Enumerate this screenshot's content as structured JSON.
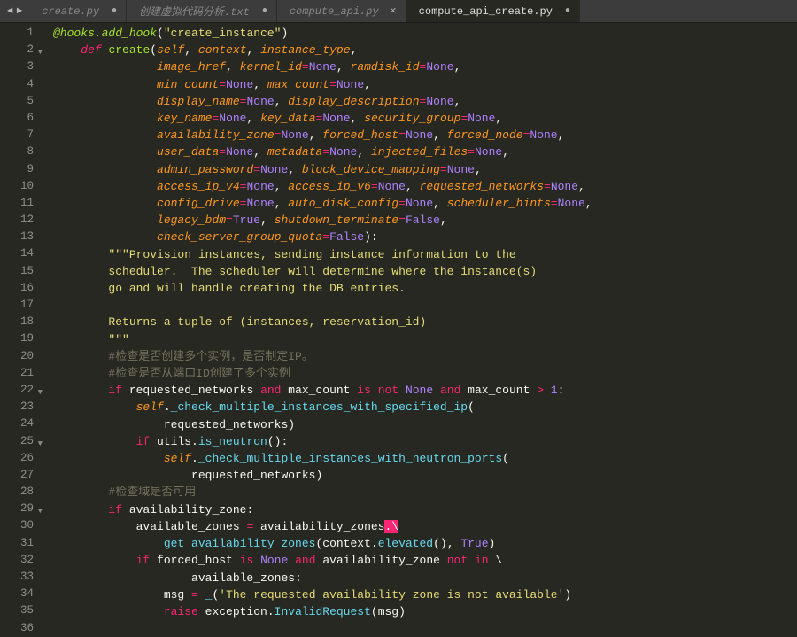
{
  "nav": {
    "back": "◄",
    "forward": "►"
  },
  "tabs": [
    {
      "label": "create.py",
      "modified": true,
      "active": false
    },
    {
      "label": "创建虚拟代码分析.txt",
      "modified": true,
      "active": false
    },
    {
      "label": "compute_api.py",
      "modified": false,
      "active": false
    },
    {
      "label": "compute_api_create.py",
      "modified": true,
      "active": true
    }
  ],
  "lines": [
    {
      "n": 1,
      "fold": "",
      "tokens": [
        [
          "dec",
          "@hooks.add_hook"
        ],
        [
          "var",
          "("
        ],
        [
          "str",
          "\"create_instance\""
        ],
        [
          "var",
          ")"
        ]
      ]
    },
    {
      "n": 2,
      "fold": "▼",
      "tokens": [
        [
          "var",
          "    "
        ],
        [
          "kwit",
          "def"
        ],
        [
          "var",
          " "
        ],
        [
          "fn",
          "create"
        ],
        [
          "var",
          "("
        ],
        [
          "param",
          "self"
        ],
        [
          "var",
          ", "
        ],
        [
          "param",
          "context"
        ],
        [
          "var",
          ", "
        ],
        [
          "param",
          "instance_type"
        ],
        [
          "var",
          ","
        ]
      ]
    },
    {
      "n": 3,
      "fold": "",
      "tokens": [
        [
          "var",
          "               "
        ],
        [
          "param",
          "image_href"
        ],
        [
          "var",
          ", "
        ],
        [
          "param",
          "kernel_id"
        ],
        [
          "op",
          "="
        ],
        [
          "const",
          "None"
        ],
        [
          "var",
          ", "
        ],
        [
          "param",
          "ramdisk_id"
        ],
        [
          "op",
          "="
        ],
        [
          "const",
          "None"
        ],
        [
          "var",
          ","
        ]
      ]
    },
    {
      "n": 4,
      "fold": "",
      "tokens": [
        [
          "var",
          "               "
        ],
        [
          "param",
          "min_count"
        ],
        [
          "op",
          "="
        ],
        [
          "const",
          "None"
        ],
        [
          "var",
          ", "
        ],
        [
          "param",
          "max_count"
        ],
        [
          "op",
          "="
        ],
        [
          "const",
          "None"
        ],
        [
          "var",
          ","
        ]
      ]
    },
    {
      "n": 5,
      "fold": "",
      "tokens": [
        [
          "var",
          "               "
        ],
        [
          "param",
          "display_name"
        ],
        [
          "op",
          "="
        ],
        [
          "const",
          "None"
        ],
        [
          "var",
          ", "
        ],
        [
          "param",
          "display_description"
        ],
        [
          "op",
          "="
        ],
        [
          "const",
          "None"
        ],
        [
          "var",
          ","
        ]
      ]
    },
    {
      "n": 6,
      "fold": "",
      "tokens": [
        [
          "var",
          "               "
        ],
        [
          "param",
          "key_name"
        ],
        [
          "op",
          "="
        ],
        [
          "const",
          "None"
        ],
        [
          "var",
          ", "
        ],
        [
          "param",
          "key_data"
        ],
        [
          "op",
          "="
        ],
        [
          "const",
          "None"
        ],
        [
          "var",
          ", "
        ],
        [
          "param",
          "security_group"
        ],
        [
          "op",
          "="
        ],
        [
          "const",
          "None"
        ],
        [
          "var",
          ","
        ]
      ]
    },
    {
      "n": 7,
      "fold": "",
      "tokens": [
        [
          "var",
          "               "
        ],
        [
          "param",
          "availability_zone"
        ],
        [
          "op",
          "="
        ],
        [
          "const",
          "None"
        ],
        [
          "var",
          ", "
        ],
        [
          "param",
          "forced_host"
        ],
        [
          "op",
          "="
        ],
        [
          "const",
          "None"
        ],
        [
          "var",
          ", "
        ],
        [
          "param",
          "forced_node"
        ],
        [
          "op",
          "="
        ],
        [
          "const",
          "None"
        ],
        [
          "var",
          ","
        ]
      ]
    },
    {
      "n": 8,
      "fold": "",
      "tokens": [
        [
          "var",
          "               "
        ],
        [
          "param",
          "user_data"
        ],
        [
          "op",
          "="
        ],
        [
          "const",
          "None"
        ],
        [
          "var",
          ", "
        ],
        [
          "param",
          "metadata"
        ],
        [
          "op",
          "="
        ],
        [
          "const",
          "None"
        ],
        [
          "var",
          ", "
        ],
        [
          "param",
          "injected_files"
        ],
        [
          "op",
          "="
        ],
        [
          "const",
          "None"
        ],
        [
          "var",
          ","
        ]
      ]
    },
    {
      "n": 9,
      "fold": "",
      "tokens": [
        [
          "var",
          "               "
        ],
        [
          "param",
          "admin_password"
        ],
        [
          "op",
          "="
        ],
        [
          "const",
          "None"
        ],
        [
          "var",
          ", "
        ],
        [
          "param",
          "block_device_mapping"
        ],
        [
          "op",
          "="
        ],
        [
          "const",
          "None"
        ],
        [
          "var",
          ","
        ]
      ]
    },
    {
      "n": 10,
      "fold": "",
      "tokens": [
        [
          "var",
          "               "
        ],
        [
          "param",
          "access_ip_v4"
        ],
        [
          "op",
          "="
        ],
        [
          "const",
          "None"
        ],
        [
          "var",
          ", "
        ],
        [
          "param",
          "access_ip_v6"
        ],
        [
          "op",
          "="
        ],
        [
          "const",
          "None"
        ],
        [
          "var",
          ", "
        ],
        [
          "param",
          "requested_networks"
        ],
        [
          "op",
          "="
        ],
        [
          "const",
          "None"
        ],
        [
          "var",
          ","
        ]
      ]
    },
    {
      "n": 11,
      "fold": "",
      "tokens": [
        [
          "var",
          "               "
        ],
        [
          "param",
          "config_drive"
        ],
        [
          "op",
          "="
        ],
        [
          "const",
          "None"
        ],
        [
          "var",
          ", "
        ],
        [
          "param",
          "auto_disk_config"
        ],
        [
          "op",
          "="
        ],
        [
          "const",
          "None"
        ],
        [
          "var",
          ", "
        ],
        [
          "param",
          "scheduler_hints"
        ],
        [
          "op",
          "="
        ],
        [
          "const",
          "None"
        ],
        [
          "var",
          ","
        ]
      ]
    },
    {
      "n": 12,
      "fold": "",
      "tokens": [
        [
          "var",
          "               "
        ],
        [
          "param",
          "legacy_bdm"
        ],
        [
          "op",
          "="
        ],
        [
          "const",
          "True"
        ],
        [
          "var",
          ", "
        ],
        [
          "param",
          "shutdown_terminate"
        ],
        [
          "op",
          "="
        ],
        [
          "const",
          "False"
        ],
        [
          "var",
          ","
        ]
      ]
    },
    {
      "n": 13,
      "fold": "",
      "tokens": [
        [
          "var",
          "               "
        ],
        [
          "param",
          "check_server_group_quota"
        ],
        [
          "op",
          "="
        ],
        [
          "const",
          "False"
        ],
        [
          "var",
          "):"
        ]
      ]
    },
    {
      "n": 14,
      "fold": "",
      "tokens": [
        [
          "var",
          "        "
        ],
        [
          "str",
          "\"\"\"Provision instances, sending instance information to the"
        ]
      ]
    },
    {
      "n": 15,
      "fold": "",
      "tokens": [
        [
          "var",
          "        "
        ],
        [
          "str",
          "scheduler.  The scheduler will determine where the instance(s)"
        ]
      ]
    },
    {
      "n": 16,
      "fold": "",
      "tokens": [
        [
          "var",
          "        "
        ],
        [
          "str",
          "go and will handle creating the DB entries."
        ]
      ]
    },
    {
      "n": 17,
      "fold": "",
      "tokens": [
        [
          "var",
          " "
        ]
      ]
    },
    {
      "n": 18,
      "fold": "",
      "tokens": [
        [
          "var",
          "        "
        ],
        [
          "str",
          "Returns a tuple of (instances, reservation_id)"
        ]
      ]
    },
    {
      "n": 19,
      "fold": "",
      "tokens": [
        [
          "var",
          "        "
        ],
        [
          "str",
          "\"\"\""
        ]
      ]
    },
    {
      "n": 20,
      "fold": "",
      "tokens": [
        [
          "var",
          "        "
        ],
        [
          "comment",
          "#检查是否创建多个实例，是否制定IP。"
        ]
      ]
    },
    {
      "n": 21,
      "fold": "",
      "tokens": [
        [
          "var",
          "        "
        ],
        [
          "comment",
          "#检查是否从端口ID创建了多个实例"
        ]
      ]
    },
    {
      "n": 22,
      "fold": "▼",
      "tokens": [
        [
          "var",
          "        "
        ],
        [
          "kw",
          "if"
        ],
        [
          "var",
          " requested_networks "
        ],
        [
          "kw",
          "and"
        ],
        [
          "var",
          " max_count "
        ],
        [
          "kw",
          "is"
        ],
        [
          "var",
          " "
        ],
        [
          "kw",
          "not"
        ],
        [
          "var",
          " "
        ],
        [
          "const",
          "None"
        ],
        [
          "var",
          " "
        ],
        [
          "kw",
          "and"
        ],
        [
          "var",
          " max_count "
        ],
        [
          "op",
          ">"
        ],
        [
          "var",
          " "
        ],
        [
          "num",
          "1"
        ],
        [
          "var",
          ":"
        ]
      ]
    },
    {
      "n": 23,
      "fold": "",
      "tokens": [
        [
          "var",
          "            "
        ],
        [
          "param",
          "self"
        ],
        [
          "var",
          "."
        ],
        [
          "call",
          "_check_multiple_instances_with_specified_ip"
        ],
        [
          "var",
          "("
        ]
      ]
    },
    {
      "n": 24,
      "fold": "",
      "tokens": [
        [
          "var",
          "                requested_networks)"
        ]
      ]
    },
    {
      "n": 25,
      "fold": "▼",
      "tokens": [
        [
          "var",
          "            "
        ],
        [
          "kw",
          "if"
        ],
        [
          "var",
          " utils."
        ],
        [
          "call",
          "is_neutron"
        ],
        [
          "var",
          "():"
        ]
      ]
    },
    {
      "n": 26,
      "fold": "",
      "tokens": [
        [
          "var",
          "                "
        ],
        [
          "param",
          "self"
        ],
        [
          "var",
          "."
        ],
        [
          "call",
          "_check_multiple_instances_with_neutron_ports"
        ],
        [
          "var",
          "("
        ]
      ]
    },
    {
      "n": 27,
      "fold": "",
      "tokens": [
        [
          "var",
          "                    requested_networks)"
        ]
      ]
    },
    {
      "n": 28,
      "fold": "",
      "tokens": [
        [
          "var",
          "        "
        ],
        [
          "comment",
          "#检查域是否可用"
        ]
      ]
    },
    {
      "n": 29,
      "fold": "▼",
      "tokens": [
        [
          "var",
          "        "
        ],
        [
          "kw",
          "if"
        ],
        [
          "var",
          " availability_zone:"
        ]
      ]
    },
    {
      "n": 30,
      "fold": "",
      "tokens": [
        [
          "var",
          "            available_zones "
        ],
        [
          "op",
          "="
        ],
        [
          "var",
          " availability_zones"
        ],
        [
          "cursor",
          ".\\"
        ]
      ]
    },
    {
      "n": 31,
      "fold": "",
      "tokens": [
        [
          "var",
          "                "
        ],
        [
          "call",
          "get_availability_zones"
        ],
        [
          "var",
          "(context."
        ],
        [
          "call",
          "elevated"
        ],
        [
          "var",
          "(), "
        ],
        [
          "const",
          "True"
        ],
        [
          "var",
          ")"
        ]
      ]
    },
    {
      "n": 32,
      "fold": "",
      "tokens": [
        [
          "var",
          "            "
        ],
        [
          "kw",
          "if"
        ],
        [
          "var",
          " forced_host "
        ],
        [
          "kw",
          "is"
        ],
        [
          "var",
          " "
        ],
        [
          "const",
          "None"
        ],
        [
          "var",
          " "
        ],
        [
          "kw",
          "and"
        ],
        [
          "var",
          " availability_zone "
        ],
        [
          "kw",
          "not"
        ],
        [
          "var",
          " "
        ],
        [
          "kw",
          "in"
        ],
        [
          "var",
          " \\"
        ]
      ]
    },
    {
      "n": 33,
      "fold": "",
      "tokens": [
        [
          "var",
          "                    available_zones:"
        ]
      ]
    },
    {
      "n": 34,
      "fold": "",
      "tokens": [
        [
          "var",
          "                msg "
        ],
        [
          "op",
          "="
        ],
        [
          "var",
          " "
        ],
        [
          "call",
          "_"
        ],
        [
          "var",
          "("
        ],
        [
          "str",
          "'The requested availability zone is not available'"
        ],
        [
          "var",
          ")"
        ]
      ]
    },
    {
      "n": 35,
      "fold": "",
      "tokens": [
        [
          "var",
          "                "
        ],
        [
          "kw",
          "raise"
        ],
        [
          "var",
          " exception."
        ],
        [
          "call",
          "InvalidRequest"
        ],
        [
          "var",
          "(msg)"
        ]
      ]
    },
    {
      "n": 36,
      "fold": "",
      "tokens": [
        [
          "var",
          " "
        ]
      ]
    }
  ]
}
